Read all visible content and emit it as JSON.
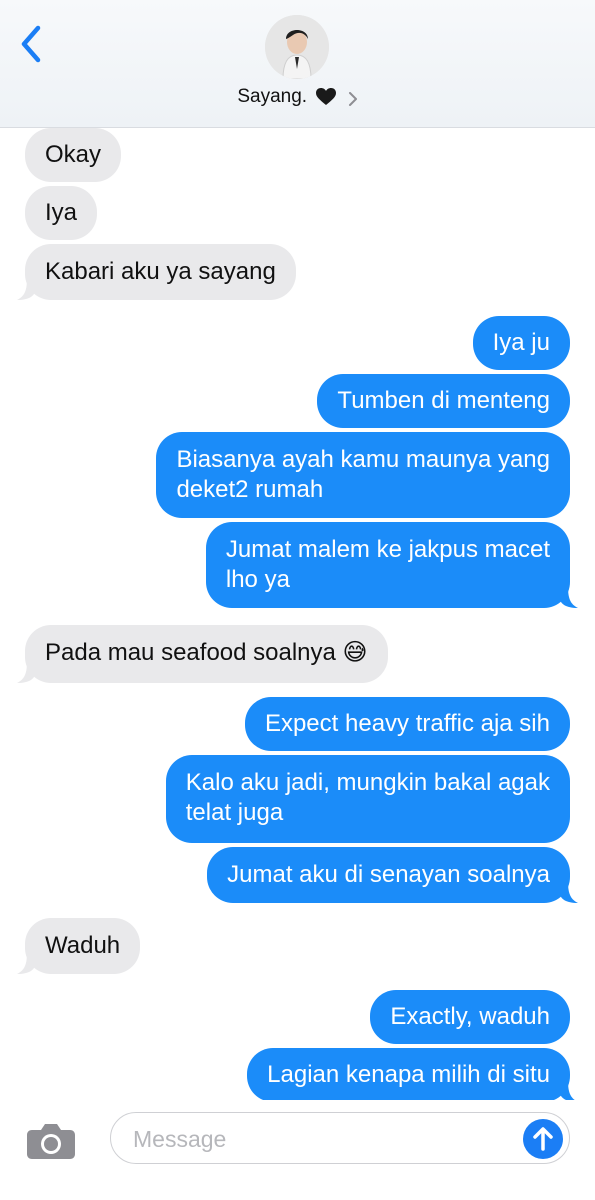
{
  "header": {
    "contact_name": "Sayang.",
    "heart_emoji": "🖤"
  },
  "messages": [
    {
      "side": "in",
      "lines": [
        "Okay"
      ]
    },
    {
      "side": "in",
      "lines": [
        "Iya"
      ]
    },
    {
      "side": "in",
      "lines": [
        "Kabari aku ya sayang"
      ]
    },
    {
      "side": "out",
      "lines": [
        "Iya ju"
      ]
    },
    {
      "side": "out",
      "lines": [
        "Tumben di menteng"
      ]
    },
    {
      "side": "out",
      "lines": [
        "Biasanya ayah kamu maunya yang",
        "deket2 rumah"
      ]
    },
    {
      "side": "out",
      "lines": [
        "Jumat malem ke jakpus macet",
        "lho ya"
      ]
    },
    {
      "side": "in",
      "lines": [
        "Pada mau seafood soalnya 😅"
      ]
    },
    {
      "side": "out",
      "lines": [
        "Expect heavy traffic aja sih"
      ]
    },
    {
      "side": "out",
      "lines": [
        "Kalo aku jadi, mungkin bakal agak",
        "telat juga"
      ]
    },
    {
      "side": "out",
      "lines": [
        "Jumat aku di senayan soalnya"
      ]
    },
    {
      "side": "in",
      "lines": [
        "Waduh"
      ]
    },
    {
      "side": "out",
      "lines": [
        "Exactly, waduh"
      ]
    },
    {
      "side": "out",
      "lines": [
        "Lagian kenapa milih di situ"
      ]
    }
  ],
  "composer": {
    "placeholder": "Message"
  },
  "colors": {
    "outgoing_bubble": "#1b8cf9",
    "incoming_bubble": "#e9e9eb",
    "accent": "#1b7ef5"
  },
  "icons": [
    "back-chevron-icon",
    "contact-avatar",
    "black-heart-icon",
    "chevron-right-icon",
    "camera-icon",
    "send-arrow-icon"
  ]
}
